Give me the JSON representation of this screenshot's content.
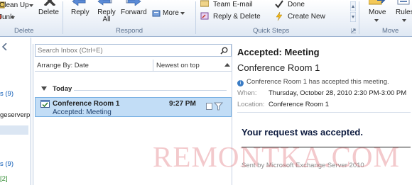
{
  "ribbon": {
    "delete_group": {
      "clean_up": "Clean Up",
      "junk": "Junk",
      "delete": "Delete",
      "label": "Delete"
    },
    "respond_group": {
      "reply": "Reply",
      "reply_all_line1": "Reply",
      "reply_all_line2": "All",
      "forward": "Forward",
      "more": "More",
      "label": "Respond"
    },
    "quick_steps_group": {
      "team_email": "Team E-mail",
      "done": "Done",
      "reply_delete": "Reply & Delete",
      "create_new": "Create New",
      "label": "Quick Steps"
    },
    "move_group": {
      "move": "Move",
      "rules": "Rules",
      "label": "Move"
    }
  },
  "folders": {
    "line1": "s (9)",
    "line2": "geserverp",
    "line3": "s (9)",
    "line4": "[2]"
  },
  "inbox": {
    "search_placeholder": "Search Inbox (Ctrl+E)",
    "arrange_label": "Arrange By: Date",
    "sort_label": "Newest on top",
    "group_today": "Today",
    "message": {
      "from": "Conference Room 1",
      "time": "9:27 PM",
      "subject": "Accepted: Meeting"
    }
  },
  "reading_pane": {
    "subject": "Accepted: Meeting",
    "location_title": "Conference Room 1",
    "info": "Conference Room 1 has accepted this meeting.",
    "when_label": "When:",
    "when_value": "Thursday, October 28, 2010 2:30 PM-3:00 PM",
    "location_label": "Location:",
    "location_value": "Conference Room 1",
    "body_main": "Your request was accepted.",
    "footer": "Sent by Microsoft Exchange Server 2010"
  },
  "watermark": "REMONTKA.COM",
  "colors": {
    "selection": "#c2ddf6",
    "selection_border": "#79b1e3",
    "ribbon_border": "#9fb5d2",
    "watermark": "#dc5a64"
  }
}
